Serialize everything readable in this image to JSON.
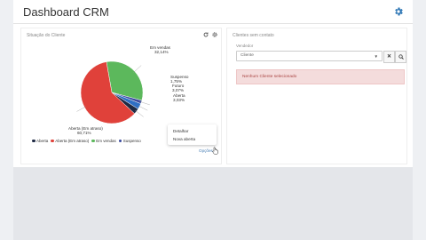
{
  "page": {
    "title": "Dashboard CRM"
  },
  "left_panel": {
    "title": "Situação do Cliente",
    "slice_labels": [
      {
        "name": "Em vendas",
        "value": "32,14%"
      },
      {
        "name": "Suspenso",
        "value": "1,75%"
      },
      {
        "name": "Futuro",
        "value": "3,07%"
      },
      {
        "name": "Aberta",
        "value": "3,03%"
      },
      {
        "name": "Aberta (Em atraso)",
        "value": "60,71%"
      }
    ],
    "legend": [
      "Aberta",
      "Aberta (Em atraso)",
      "Em vendas",
      "Suspenso"
    ],
    "dropdown": {
      "items": [
        "Detalhar",
        "Nova aberta"
      ]
    },
    "options_link": "Opções"
  },
  "right_panel": {
    "title": "Clientes sem contato",
    "field_label": "Vendedor",
    "select_value": "Cliente",
    "alert_text": "Nenhum Cliente selecionado"
  },
  "chart_data": {
    "type": "pie",
    "title": "Situação do Cliente",
    "categories": [
      "Em vendas",
      "Suspenso",
      "Futuro",
      "Aberta",
      "Aberta (Em atraso)"
    ],
    "values": [
      32.14,
      1.75,
      3.07,
      3.03,
      60.71
    ],
    "colors": [
      "#5cb85c",
      "#3b4a9e",
      "#2f6fc4",
      "#1f2a44",
      "#e0413a"
    ],
    "legend_position": "bottom-left"
  },
  "colors": {
    "accent": "#337ab7",
    "alert_bg": "#f4dcdc",
    "alert_text": "#a94442"
  },
  "icons": {
    "header_settings": "gear-icon",
    "panel_refresh": "refresh-icon",
    "panel_settings": "gear-icon",
    "search": "search-icon",
    "clear": "close-icon"
  }
}
